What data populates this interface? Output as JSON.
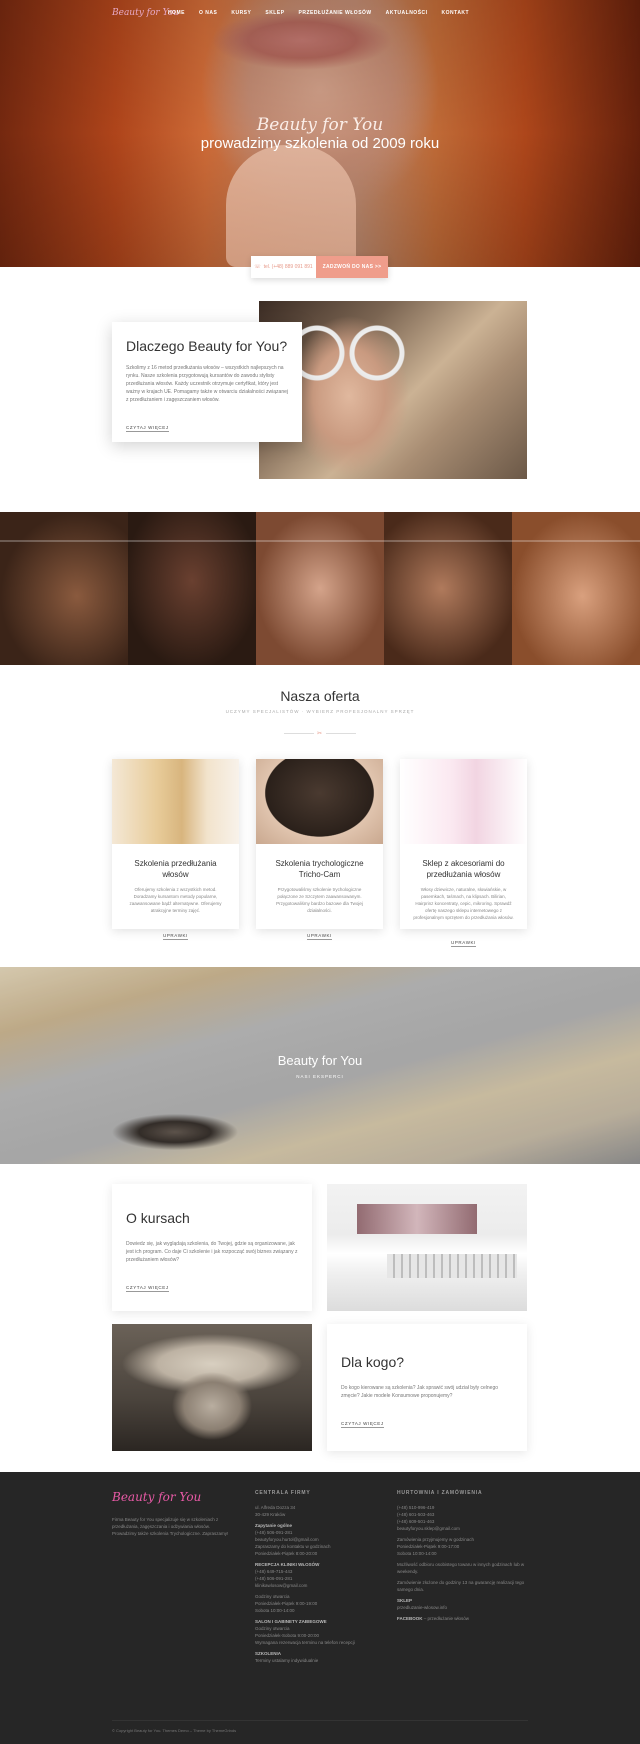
{
  "nav": {
    "logo": "Beauty for You",
    "items": [
      "HOME",
      "O NAS",
      "KURSY",
      "SKLEP",
      "PRZEDŁUŻANIE WŁOSÓW",
      "AKTUALNOŚCI",
      "KONTAKT"
    ]
  },
  "hero": {
    "script": "Beauty for You",
    "title": "prowadzimy szkolenia od 2009 roku"
  },
  "cta": {
    "phone": "tel. (+48) 889 091 891",
    "button": "ZADZWOŃ DO NAS >>"
  },
  "why": {
    "title": "Dlaczego Beauty for You?",
    "text": "Szkolimy z 16 metod przedłużania włosów – wszystkich najlepszych na rynku. Nasze szkolenia przygotowują kursantów do zawodu stylisty przedłużania włosów. Każdy uczestnik otrzymuje certyfikat, który jest ważny w krajach UE. Pomagamy także w otwarciu działalności związanej z przedłużaniem i zagęszczaniem włosów.",
    "more": "CZYTAJ WIĘCEJ"
  },
  "offer": {
    "title": "Nasza oferta",
    "subtitle": "UCZYMY SPECJALISTÓW · WYBIERZ PROFESJONALNY SPRZĘT",
    "divider_icon": "✂",
    "items": [
      {
        "title": "Szkolenia przedłużania włosów",
        "desc": "Oferujemy szkolenia z wszystkich metod. Doradzamy kursantom metody popularne, zaawansowane bądź alternatywne. Oferujemy atrakcyjne terminy zajęć.",
        "more": "UPRAWKI"
      },
      {
        "title": "Szkolenia trychologiczne Tricho-Cam",
        "desc": "Przygotowaliśmy szkolenie trychologiczne połączone ze Szczytem zaawansowanym. Przygotowaliśmy bardzo bazowe dla Twojej działalności.",
        "more": "UPRAWKI"
      },
      {
        "title": "Sklep z akcesoriami do przedłużania włosów",
        "desc": "Włosy dziewicze, naturalne, słowiańskie, w pasemkach, taśmach, na klipsach. Bilirian, Hairprinz koncentraty, cepic, mikroring. Sprawdź ofertę naszego sklepu internetowego z profesjonalnym sprzętem do przedłużania włosów.",
        "more": "UPRAWKI"
      }
    ]
  },
  "banner": {
    "title": "Beauty for You",
    "subtitle": "NASI EKSPERCI"
  },
  "courses": {
    "title": "O kursach",
    "text": "Dowiedz się, jak wyglądają szkolenia, do Twojej, gdzie są organizowane, jak jest ich program. Co daje Ci szkolenie i jak rozpocząć swój biznes związany z przedłużaniem włosów?",
    "more": "CZYTAJ WIĘCEJ"
  },
  "forwhom": {
    "title": "Dla kogo?",
    "text": "Do kogo kierowane są szkolenia? Jak sprawić swój udział były celnego zmęcie? Jakie modele Konsumowe proponujemy?",
    "more": "CZYTAJ WIĘCEJ"
  },
  "footer": {
    "logo": "Beauty for You",
    "about": "Firma Beauty for You specjalizuje się w szkoleniach z przedłużania, zagęszczania i odżywiania włosów. Prowadzimy także szkolenia Trychologiczne. Zapraszamy!",
    "col2_h": "CENTRALA FIRMY",
    "col2_addr": [
      "ul. Alfreda Dozza 34",
      "30-429 Kraków"
    ],
    "col2_s1": "Zapytanie ogólne",
    "col2_t1": [
      "(+48) 506-091-281",
      "beautyforyou.hurtol@gmail.com",
      "Zapraszamy do kontaktu w godzinach",
      "Poniedziałek-Piątek 8:00-20:00"
    ],
    "col2_s2": "RECEPCJA KLINIKI WŁOSÓW",
    "col2_t2": [
      "(+48) 649-715-443",
      "(+48) 506-091-281",
      "klinikawlosow@gmail.com"
    ],
    "col2_t3": [
      "Godziny otwarcia",
      "Poniedziałek-Piątek 9:00-19:00",
      "Sobota 10:00-14:00"
    ],
    "col2_s3": "SALON I GABINETY ZABIEGOWE",
    "col2_t4": [
      "Godziny otwarcia",
      "Poniedziałek-Sobota 9:00-20:00",
      "Wymagana rezerwacja terminu na telefon recepcji"
    ],
    "col2_s4": "SZKOLENIA",
    "col2_t5": [
      "Terminy ustalamy indywidualnie"
    ],
    "col3_h": "HURTOWNIA I ZAMÓWIENIA",
    "col3_t1": [
      "(+48) 510-996-419",
      "(+48) 601-503-463",
      "(+48) 609-501-463",
      "beautyforyou.sklep@gmail.com"
    ],
    "col3_t2": [
      "Zamówienia przyjmujemy w godzinach",
      "Poniedziałek-Piątek 9:00-17:00",
      "Sobota 10:00-14:00"
    ],
    "col3_t3": [
      "Możliwość odbioru osobistego towaru w innych godzinach lub w weekendy."
    ],
    "col3_t4": [
      "Zamówienie złożone do godziny 13 na gwarancję realizacji tego samego dnia."
    ],
    "col3_s1": "SKLEP",
    "col3_t5": [
      "przedluzanie-wlosow.info"
    ],
    "col3_s2": "FACEBOOK",
    "col3_s2b": " – przedłużanie włosów",
    "copyright": "© Copyright Beauty for You. Themes Demo – Theme by ThemeGrinds"
  }
}
